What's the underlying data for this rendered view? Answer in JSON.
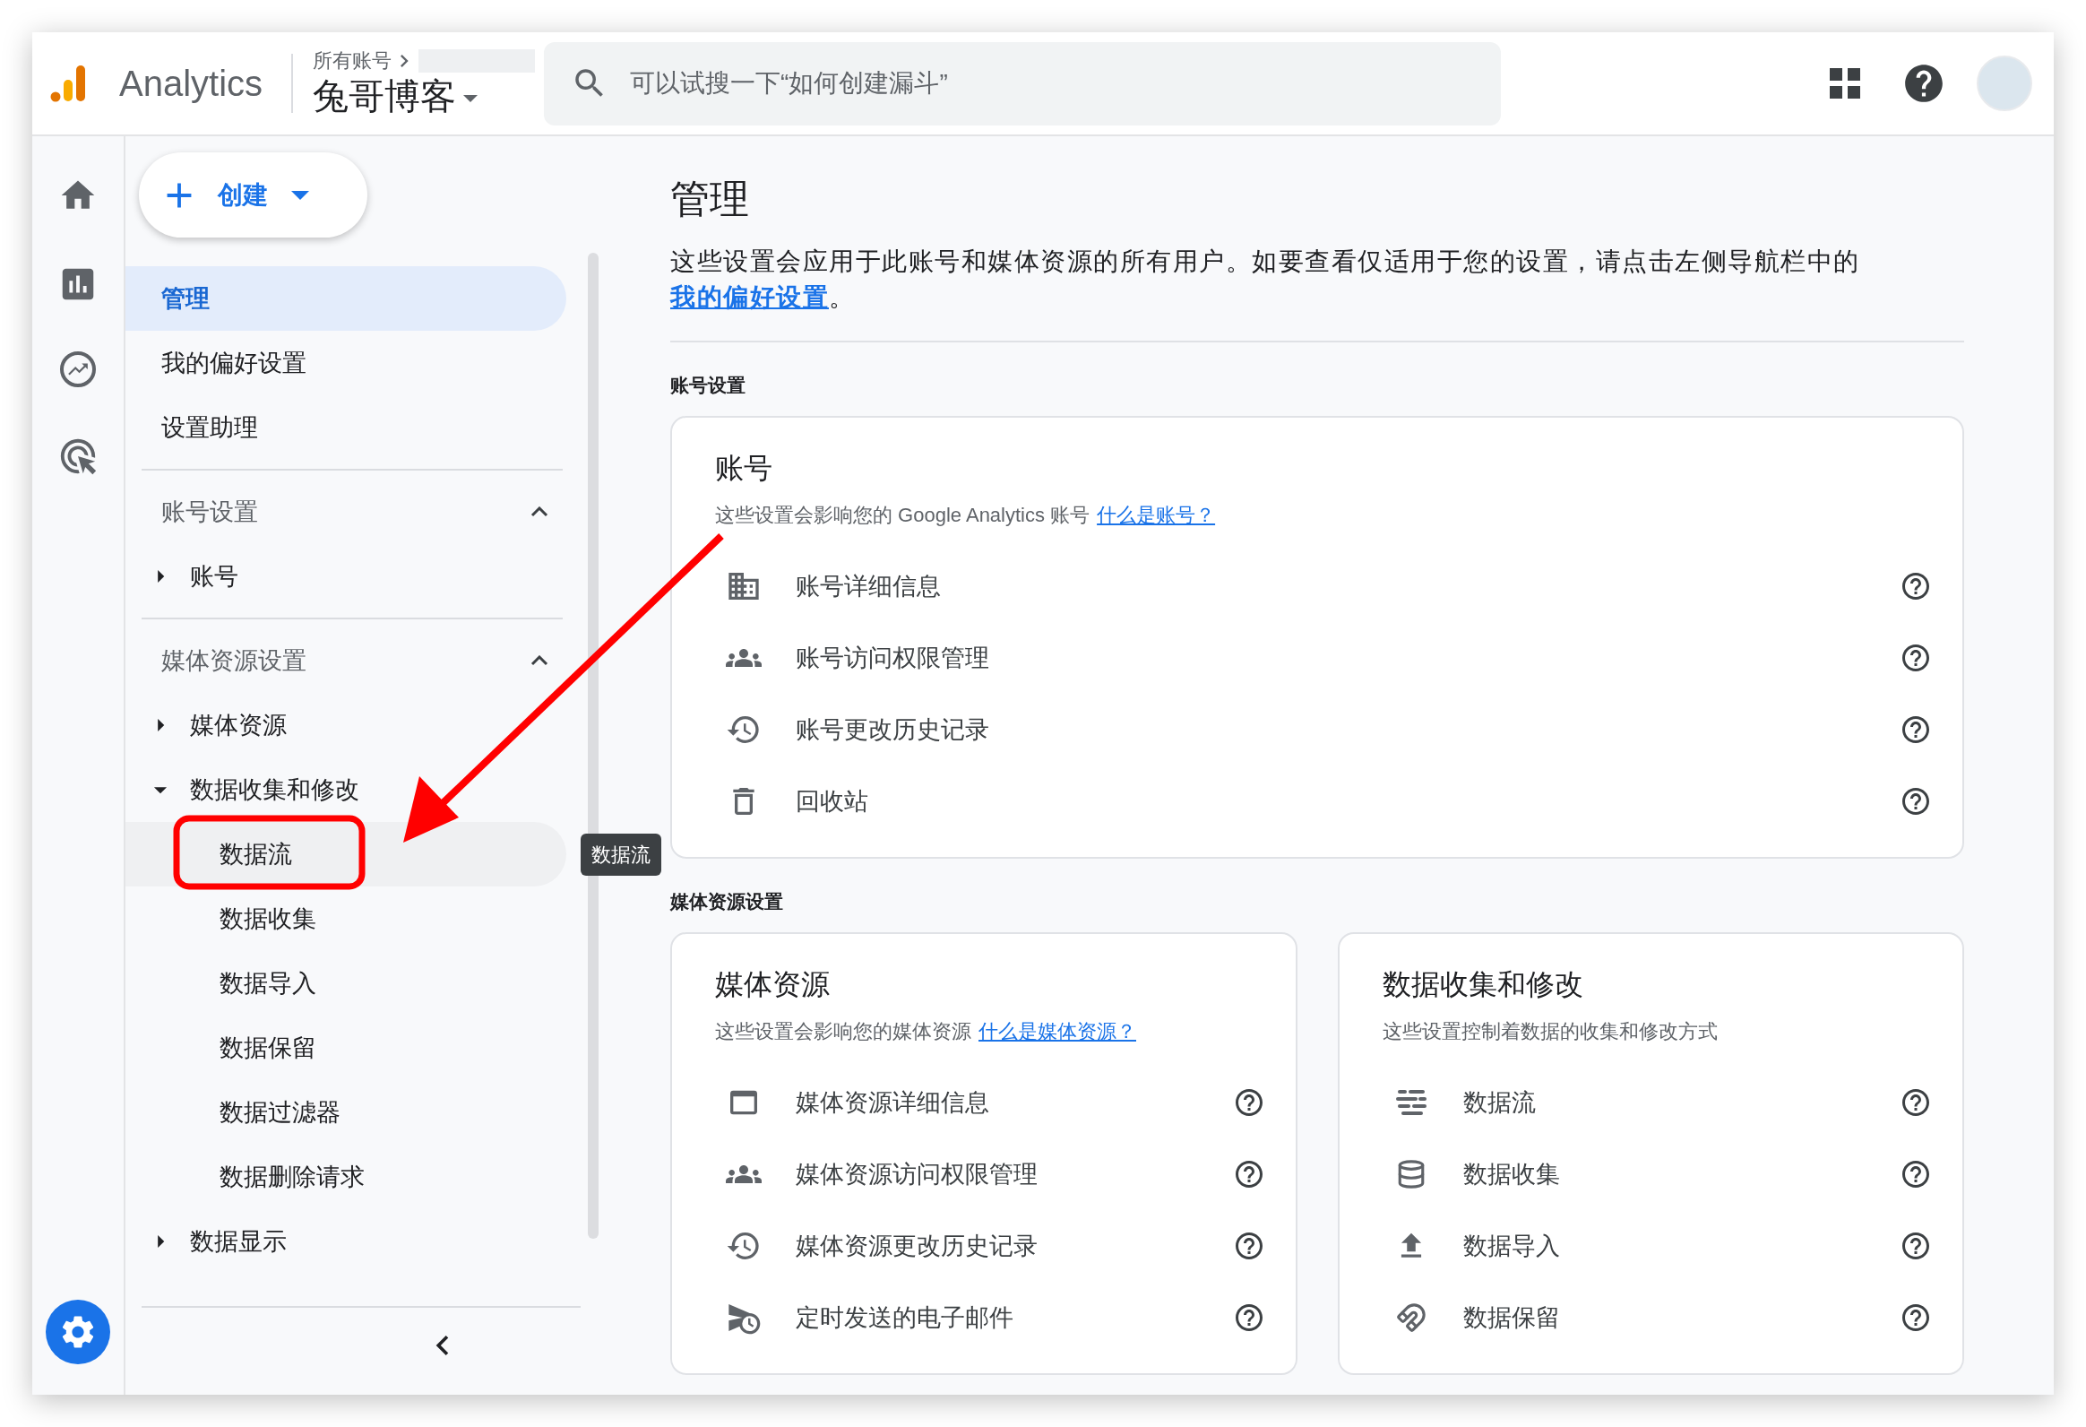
{
  "header": {
    "product": "Analytics",
    "breadcrumb": "所有账号",
    "account": "兔哥博客",
    "search": {
      "placeholder": "可以试搜一下“如何创建漏斗”"
    }
  },
  "nav": {
    "create": "创建",
    "items": [
      {
        "label": "管理",
        "selected": true
      },
      {
        "label": "我的偏好设置",
        "selected": false
      },
      {
        "label": "设置助理",
        "selected": false
      }
    ],
    "sections": [
      {
        "title": "账号设置",
        "expanded": true,
        "items": [
          {
            "label": "账号",
            "expanded": false
          }
        ]
      },
      {
        "title": "媒体资源设置",
        "expanded": true,
        "items": [
          {
            "label": "媒体资源",
            "expanded": false
          },
          {
            "label": "数据收集和修改",
            "expanded": true,
            "children": [
              {
                "label": "数据流",
                "hovered": true
              },
              {
                "label": "数据收集",
                "hovered": false
              },
              {
                "label": "数据导入",
                "hovered": false
              },
              {
                "label": "数据保留",
                "hovered": false
              },
              {
                "label": "数据过滤器",
                "hovered": false
              },
              {
                "label": "数据删除请求",
                "hovered": false
              }
            ]
          },
          {
            "label": "数据显示",
            "expanded": false
          }
        ]
      }
    ]
  },
  "tooltip": "数据流",
  "main": {
    "title": "管理",
    "description": {
      "text": "这些设置会应用于此账号和媒体资源的所有用户。如要查看仅适用于您的设置，请点击左侧导航栏中的",
      "link": "我的偏好设置",
      "text_after": "。"
    },
    "sections": [
      {
        "label": "账号设置",
        "cards": [
          {
            "title": "账号",
            "subtitle": "这些设置会影响您的 Google Analytics 账号",
            "link": "什么是账号？",
            "rows": [
              {
                "kind": "building",
                "label": "账号详细信息"
              },
              {
                "kind": "people",
                "label": "账号访问权限管理"
              },
              {
                "kind": "history",
                "label": "账号更改历史记录"
              },
              {
                "kind": "trash",
                "label": "回收站"
              }
            ]
          }
        ]
      },
      {
        "label": "媒体资源设置",
        "cards": [
          {
            "title": "媒体资源",
            "subtitle": "这些设置会影响您的媒体资源",
            "link": "什么是媒体资源？",
            "rows": [
              {
                "kind": "property",
                "label": "媒体资源详细信息"
              },
              {
                "kind": "people",
                "label": "媒体资源访问权限管理"
              },
              {
                "kind": "history",
                "label": "媒体资源更改历史记录"
              },
              {
                "kind": "schedule",
                "label": "定时发送的电子邮件"
              }
            ]
          },
          {
            "title": "数据收集和修改",
            "subtitle": "这些设置控制着数据的收集和修改方式",
            "rows": [
              {
                "kind": "streams",
                "label": "数据流"
              },
              {
                "kind": "database",
                "label": "数据收集"
              },
              {
                "kind": "upload",
                "label": "数据导入"
              },
              {
                "kind": "magnet",
                "label": "数据保留"
              }
            ]
          }
        ]
      }
    ]
  }
}
